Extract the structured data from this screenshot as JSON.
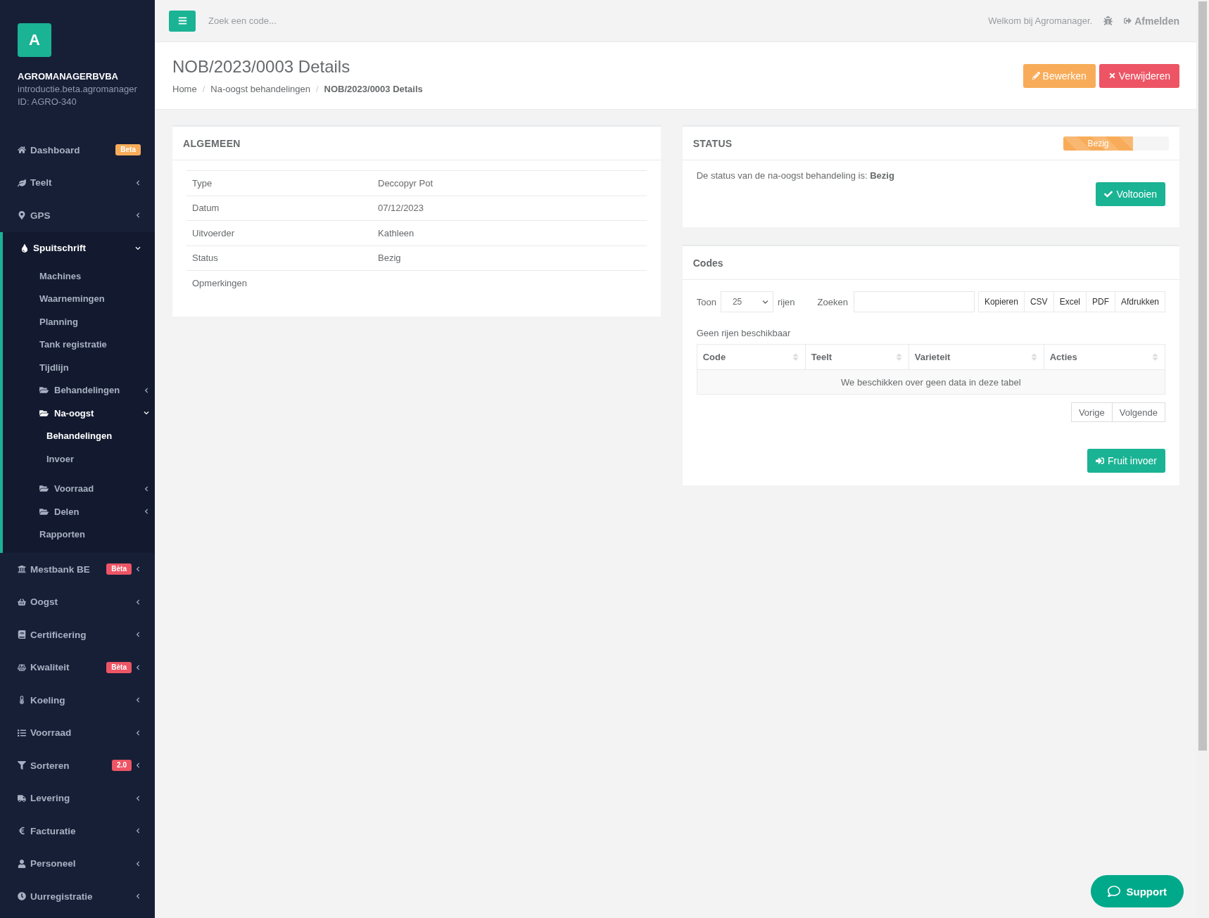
{
  "brand": {
    "logo": "A",
    "company": "AGROMANAGERBVBA",
    "domain": "introductie.beta.agromanager",
    "account_id": "ID: AGRO-340"
  },
  "sidebar": {
    "items": [
      {
        "label": "Dashboard",
        "selected": false,
        "badge": {
          "text": "Beta",
          "color": "#f8ac59"
        }
      },
      {
        "label": "Teelt",
        "selected": false,
        "expanded": false
      },
      {
        "label": "GPS",
        "selected": false,
        "expanded": false
      },
      {
        "label": "Spuitschrift",
        "selected": true,
        "expanded": true,
        "children": [
          {
            "kind": "link",
            "label": "Machines",
            "selected": false
          },
          {
            "kind": "link",
            "label": "Waarnemingen",
            "selected": false
          },
          {
            "kind": "link",
            "label": "Planning",
            "selected": false
          },
          {
            "kind": "link",
            "label": "Tank registratie",
            "selected": false
          },
          {
            "kind": "link",
            "label": "Tijdlijn",
            "selected": false
          },
          {
            "kind": "folder",
            "label": "Behandelingen",
            "selected": false,
            "expanded": false
          },
          {
            "kind": "folder",
            "label": "Na-oogst",
            "selected": true,
            "expanded": true,
            "children": [
              {
                "label": "Behandelingen",
                "selected": true
              },
              {
                "label": "Invoer",
                "selected": false
              }
            ]
          },
          {
            "kind": "folder",
            "label": "Voorraad",
            "selected": false,
            "expanded": false
          },
          {
            "kind": "folder",
            "label": "Delen",
            "selected": false,
            "expanded": false
          },
          {
            "kind": "link",
            "label": "Rapporten",
            "selected": false
          }
        ]
      },
      {
        "label": "Mestbank BE",
        "selected": false,
        "expanded": false,
        "badge": {
          "text": "Bèta",
          "color": "#ed5565"
        }
      },
      {
        "label": "Oogst",
        "selected": false,
        "expanded": false
      },
      {
        "label": "Certificering",
        "selected": false,
        "expanded": false
      },
      {
        "label": "Kwaliteit",
        "selected": false,
        "expanded": false,
        "badge": {
          "text": "Bèta",
          "color": "#ed5565"
        }
      },
      {
        "label": "Koeling",
        "selected": false,
        "expanded": false
      },
      {
        "label": "Voorraad",
        "selected": false,
        "expanded": false
      },
      {
        "label": "Sorteren",
        "selected": false,
        "expanded": false,
        "badge": {
          "text": "2.0",
          "color": "#ed5565"
        }
      },
      {
        "label": "Levering",
        "selected": false,
        "expanded": false
      },
      {
        "label": "Facturatie",
        "selected": false,
        "expanded": false
      },
      {
        "label": "Personeel",
        "selected": false,
        "expanded": false
      },
      {
        "label": "Uurregistratie",
        "selected": false,
        "expanded": false
      }
    ]
  },
  "topbar": {
    "search": {
      "placeholder": "Zoek een code..."
    },
    "welcome": "Welkom bij Agromanager.",
    "logout": "Afmelden"
  },
  "header": {
    "title": "NOB/2023/0003 Details",
    "separator": "/",
    "breadcrumbs": [
      {
        "label": "Home",
        "selected": false
      },
      {
        "label": "Na-oogst behandelingen",
        "selected": false
      },
      {
        "label": "NOB/2023/0003 Details",
        "selected": true
      }
    ],
    "buttons": [
      {
        "kind": "edit",
        "label": "Bewerken"
      },
      {
        "kind": "delete",
        "label": "Verwijderen"
      }
    ]
  },
  "general": {
    "title": "ALGEMEEN",
    "rows": [
      {
        "label": "Type",
        "value": "Deccopyr Pot"
      },
      {
        "label": "Datum",
        "value": "07/12/2023"
      },
      {
        "label": "Uitvoerder",
        "value": "Kathleen"
      },
      {
        "label": "Status",
        "value": "Bezig"
      },
      {
        "label": "Opmerkingen"
      }
    ]
  },
  "status": {
    "title": "STATUS",
    "progress": {
      "label": "Bezig",
      "level": 0.66
    },
    "message": "De status van de na-oogst behandeling is: **Bezig**",
    "button": "Voltooien"
  },
  "codes": {
    "title": "Codes",
    "length": {
      "prefix": "Toon",
      "value": "25",
      "suffix": "rijen"
    },
    "search_label": "Zoeken",
    "export_buttons": [
      "Kopieren",
      "CSV",
      "Excel",
      "PDF",
      "Afdrukken"
    ],
    "info": "Geen rijen beschikbaar",
    "columns": [
      "Code",
      "Teelt",
      "Varieteit",
      "Acties"
    ],
    "empty_message": "We beschikken over geen data in deze tabel",
    "pagination": [
      "Vorige",
      "Volgende"
    ],
    "action_button": "Fruit invoer"
  },
  "support": "Support"
}
